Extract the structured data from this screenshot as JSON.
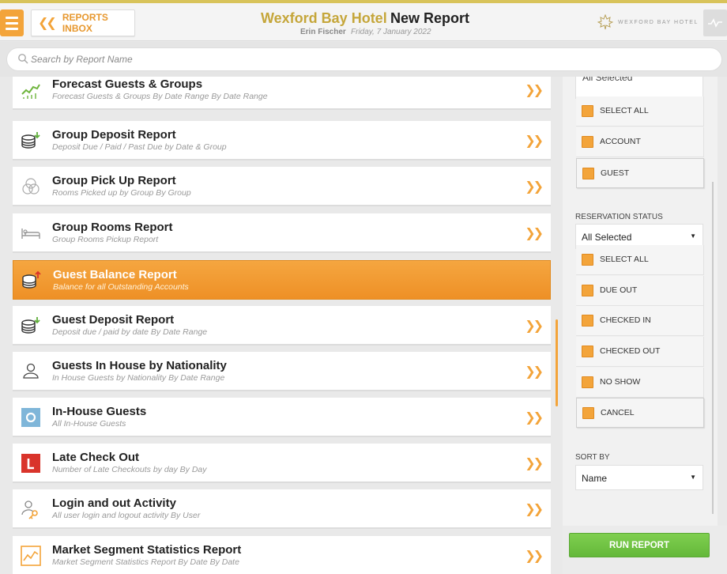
{
  "header": {
    "menu_icon": "hamburger-icon",
    "inbox_label": "REPORTS INBOX",
    "hotel_name": "Wexford Bay Hotel",
    "report_title": "New Report",
    "user": "Erin Fischer",
    "date": "Friday, 7 January 2022",
    "logo_text": "WEXFORD BAY HOTEL"
  },
  "search": {
    "placeholder": "Search by Report Name"
  },
  "reports": [
    {
      "name": "Forecast Guests & Groups",
      "desc": "Forecast Guests & Groups By Date Range By Date Range",
      "icon": "trend-chart-icon"
    },
    {
      "name": "Group Deposit Report",
      "desc": "Deposit Due / Paid / Past Due by Date & Group",
      "icon": "coins-deposit-icon"
    },
    {
      "name": "Group Pick Up Report",
      "desc": "Rooms Picked up by Group By Group",
      "icon": "group-circles-icon"
    },
    {
      "name": "Group Rooms Report",
      "desc": "Group Rooms Pickup Report",
      "icon": "bed-icon"
    },
    {
      "name": "Guest Balance Report",
      "desc": "Balance for all Outstanding Accounts",
      "icon": "coins-balance-icon",
      "active": true
    },
    {
      "name": "Guest Deposit Report",
      "desc": "Deposit due / paid by date By Date Range",
      "icon": "coins-deposit-icon"
    },
    {
      "name": "Guests In House by Nationality",
      "desc": "In House Guests by Nationality By Date Range",
      "icon": "person-icon"
    },
    {
      "name": "In-House Guests",
      "desc": "All In-House Guests",
      "icon": "in-house-badge-icon"
    },
    {
      "name": "Late Check Out",
      "desc": "Number of Late Checkouts by day By Day",
      "icon": "late-badge-icon"
    },
    {
      "name": "Login and out Activity",
      "desc": "All user login and logout activity By User",
      "icon": "user-key-icon"
    },
    {
      "name": "Market Segment Statistics Report",
      "desc": "Market Segment Statistics Report By Date By Date",
      "icon": "line-chart-icon"
    }
  ],
  "filters": {
    "top_dropdown_value": "All Selected",
    "account_type_options": [
      "SELECT ALL",
      "ACCOUNT",
      "GUEST"
    ],
    "reservation_status": {
      "label": "RESERVATION STATUS",
      "value": "All Selected",
      "options": [
        "SELECT ALL",
        "DUE OUT",
        "CHECKED IN",
        "CHECKED OUT",
        "NO SHOW",
        "CANCEL"
      ]
    },
    "sort_by": {
      "label": "SORT BY",
      "value": "Name"
    }
  },
  "run_label": "RUN REPORT",
  "colors": {
    "accent": "#f3a43a",
    "gold": "#c5a63a",
    "run": "#6cc242"
  }
}
